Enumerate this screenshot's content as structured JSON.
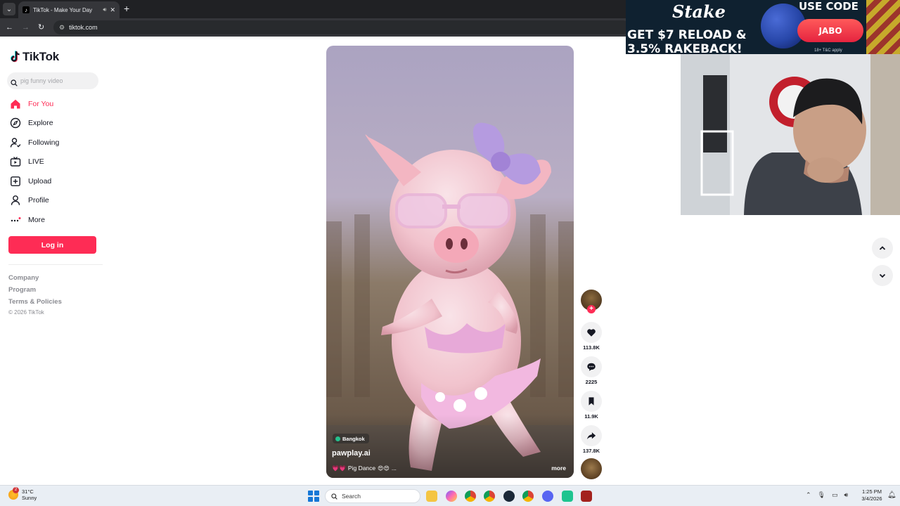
{
  "browser": {
    "tab_title": "TikTok - Make Your Day",
    "url": "tiktok.com"
  },
  "sidebar": {
    "logo_text": "TikTok",
    "search_placeholder": "pig funny video",
    "nav": [
      {
        "label": "For You",
        "icon": "home-icon",
        "active": true
      },
      {
        "label": "Explore",
        "icon": "compass-icon",
        "active": false
      },
      {
        "label": "Following",
        "icon": "following-icon",
        "active": false
      },
      {
        "label": "LIVE",
        "icon": "live-icon",
        "active": false
      },
      {
        "label": "Upload",
        "icon": "upload-icon",
        "active": false
      },
      {
        "label": "Profile",
        "icon": "profile-icon",
        "active": false
      },
      {
        "label": "More",
        "icon": "more-icon",
        "active": false
      }
    ],
    "login_label": "Log in",
    "footer": {
      "company": "Company",
      "program": "Program",
      "terms": "Terms & Policies",
      "copyright": "© 2026 TikTok"
    }
  },
  "video": {
    "location": "Bangkok",
    "author": "pawplay.ai",
    "caption": "Pig Dance",
    "caption_suffix": "...",
    "more_label": "more"
  },
  "actions": {
    "likes": "113.8K",
    "comments": "2225",
    "saves": "11.9K",
    "shares": "137.8K"
  },
  "ad": {
    "brand": "Stake",
    "headline_line1": "GET $7 RELOAD &",
    "headline_line2": "3.5% RAKEBACK!",
    "use_code_label": "USE CODE",
    "code": "JABO",
    "terms": "18+ T&C apply"
  },
  "taskbar": {
    "temperature": "31°C",
    "condition": "Sunny",
    "weather_badge": "2",
    "search_label": "Search",
    "time": "1:25 PM",
    "date": "3/4/2026"
  },
  "colors": {
    "accent": "#fe2c55",
    "text": "#161823",
    "muted": "#8a8b91"
  }
}
